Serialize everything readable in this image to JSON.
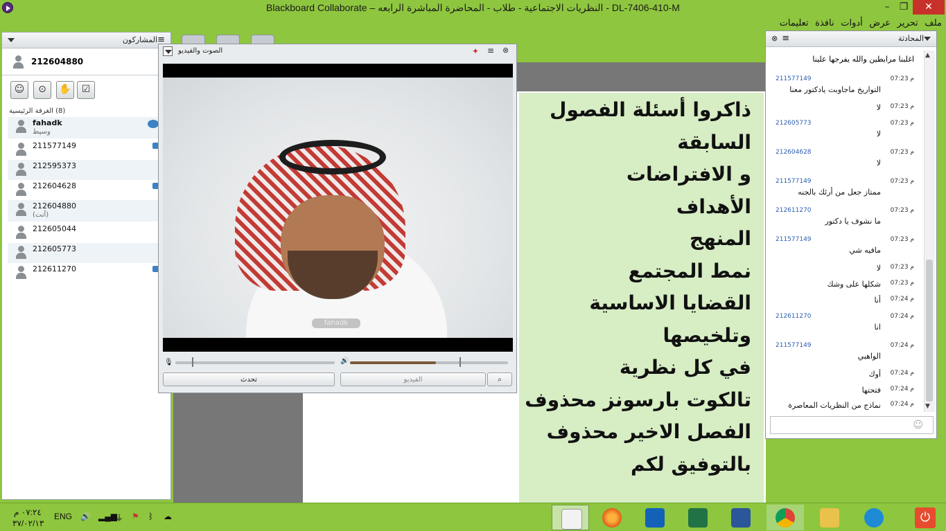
{
  "window": {
    "title": "Blackboard Collaborate – النظريات الاجتماعية - طلاب - المحاضرة المباشرة الرابعه - DL-7406-410-M",
    "minimize": "–",
    "restore": "❐",
    "close": "✕"
  },
  "menu": [
    "ملف",
    "تحرير",
    "عرض",
    "أدوات",
    "نافذة",
    "تعليمات"
  ],
  "participants": {
    "header": "المشاركون",
    "me": "212604880",
    "room_label": "(8) الغرفة الرئيسية",
    "list": [
      {
        "name": "fahadk",
        "sub": "وسيط"
      },
      {
        "name": "211577149",
        "sub": ""
      },
      {
        "name": "212595373",
        "sub": ""
      },
      {
        "name": "212604628",
        "sub": ""
      },
      {
        "name": "212604880",
        "sub": "(أنت)"
      },
      {
        "name": "212605044",
        "sub": ""
      },
      {
        "name": "212605773",
        "sub": ""
      },
      {
        "name": "212611270",
        "sub": ""
      }
    ]
  },
  "av": {
    "header": "الصوت والفيديو",
    "video_label": "fahadk",
    "talk_button": "تحدث",
    "video_button": "الفيديو"
  },
  "slide": {
    "lines": [
      "ذاكروا أسئلة الفصول",
      "السابقة",
      "",
      "و الافتراضات",
      "الأهداف",
      "المنهج",
      "نمط المجتمع",
      "القضايا الاساسية",
      "وتلخيصها",
      "في كل نظرية",
      "تالكوت بارسونز محذوف",
      "الفصل الاخير محذوف",
      "بالتوفيق لكم"
    ]
  },
  "chat": {
    "header": "المحادثة",
    "top_partial": "اغلبنا مرابطين والله يفرجها علينا",
    "messages": [
      {
        "user": "211577149",
        "time": "م 07:23",
        "text": "التواريخ ماجاوبت يادكتور معنا"
      },
      {
        "user": "",
        "time": "م 07:23",
        "text": "لا"
      },
      {
        "user": "212605773",
        "time": "م 07:23",
        "text": "لا"
      },
      {
        "user": "212604628",
        "time": "م 07:23",
        "text": "لا"
      },
      {
        "user": "211577149",
        "time": "م 07:23",
        "text": "ممتاز جعل من أرئك بالجنه"
      },
      {
        "user": "212611270",
        "time": "م 07:23",
        "text": "ما نشوف يا دكتور"
      },
      {
        "user": "211577149",
        "time": "م 07:23",
        "text": "مافيه شي"
      },
      {
        "user": "",
        "time": "م 07:23",
        "text": "لا"
      },
      {
        "user": "",
        "time": "م 07:23",
        "text": "شكلها على وشك"
      },
      {
        "user": "",
        "time": "م 07:24",
        "text": "أنا"
      },
      {
        "user": "212611270",
        "time": "م 07:24",
        "text": "انا"
      },
      {
        "user": "211577149",
        "time": "م 07:24",
        "text": "الواهبي"
      },
      {
        "user": "",
        "time": "م 07:24",
        "text": "أوك"
      },
      {
        "user": "",
        "time": "م 07:24",
        "text": "فتحتها"
      },
      {
        "user": "",
        "time": "م 07:24",
        "text": "نماذج من النظريات المعاصرة"
      }
    ]
  },
  "taskbar": {
    "lang": "ENG",
    "time": "٠٧:٢٤ م",
    "date": "٣٧/٠٢/١٣"
  },
  "colors": {
    "bg_green": "#8ec63f",
    "slide_green": "#d7edc4",
    "close_red": "#c8312a"
  }
}
